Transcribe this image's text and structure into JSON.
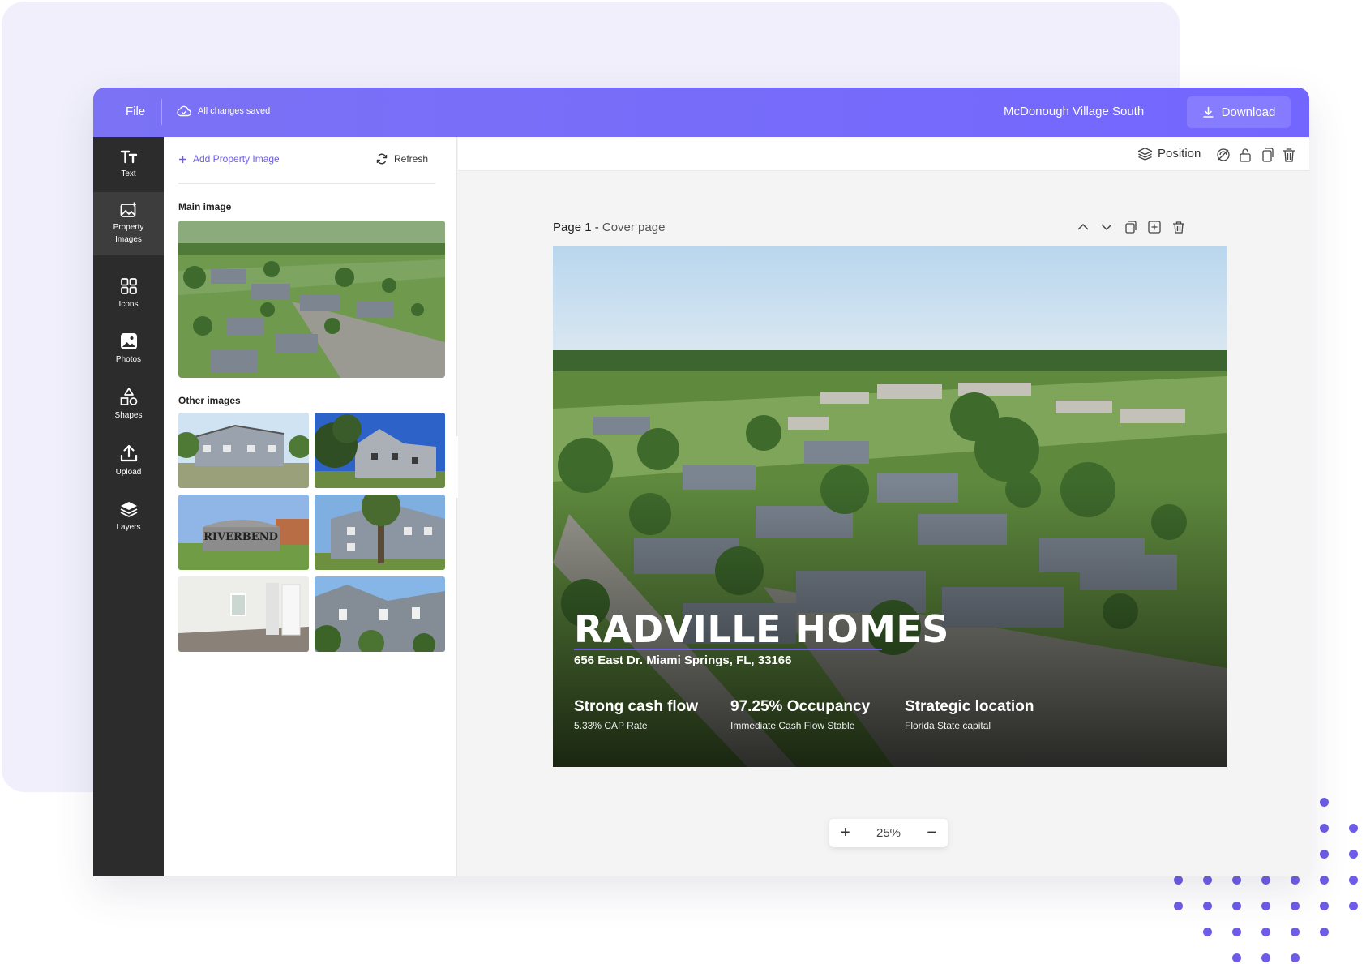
{
  "topbar": {
    "file_label": "File",
    "saved_status": "All changes saved",
    "document_title": "McDonough Village South",
    "download_label": "Download"
  },
  "sidebar": {
    "items": [
      {
        "label": "Text",
        "icon": "text-icon"
      },
      {
        "label": "Property Images",
        "icon": "property-images-icon"
      },
      {
        "label": "Icons",
        "icon": "grid-icon"
      },
      {
        "label": "Photos",
        "icon": "photo-icon"
      },
      {
        "label": "Shapes",
        "icon": "shapes-icon"
      },
      {
        "label": "Upload",
        "icon": "upload-icon"
      },
      {
        "label": "Layers",
        "icon": "layers-icon"
      }
    ]
  },
  "panel": {
    "add_image_label": "Add Property Image",
    "refresh_label": "Refresh",
    "main_image_heading": "Main image",
    "other_images_heading": "Other images"
  },
  "canvas_toolbar": {
    "position_label": "Position"
  },
  "page": {
    "number_label": "Page 1 - ",
    "name": "Cover page"
  },
  "cover": {
    "title": "RADVILLE HOMES",
    "address": "656 East Dr. Miami Springs, FL, 33166",
    "stats": [
      {
        "heading": "Strong cash flow",
        "sub": "5.33% CAP Rate"
      },
      {
        "heading": "97.25% Occupancy",
        "sub": "Immediate Cash Flow Stable"
      },
      {
        "heading": "Strategic location",
        "sub": "Florida State capital"
      }
    ]
  },
  "zoom": {
    "plus": "+",
    "level": "25%",
    "minus": "−"
  },
  "colors": {
    "accent": "#6c5ce7",
    "topbar": "#7366ff",
    "sidebar": "#2c2c2c"
  }
}
